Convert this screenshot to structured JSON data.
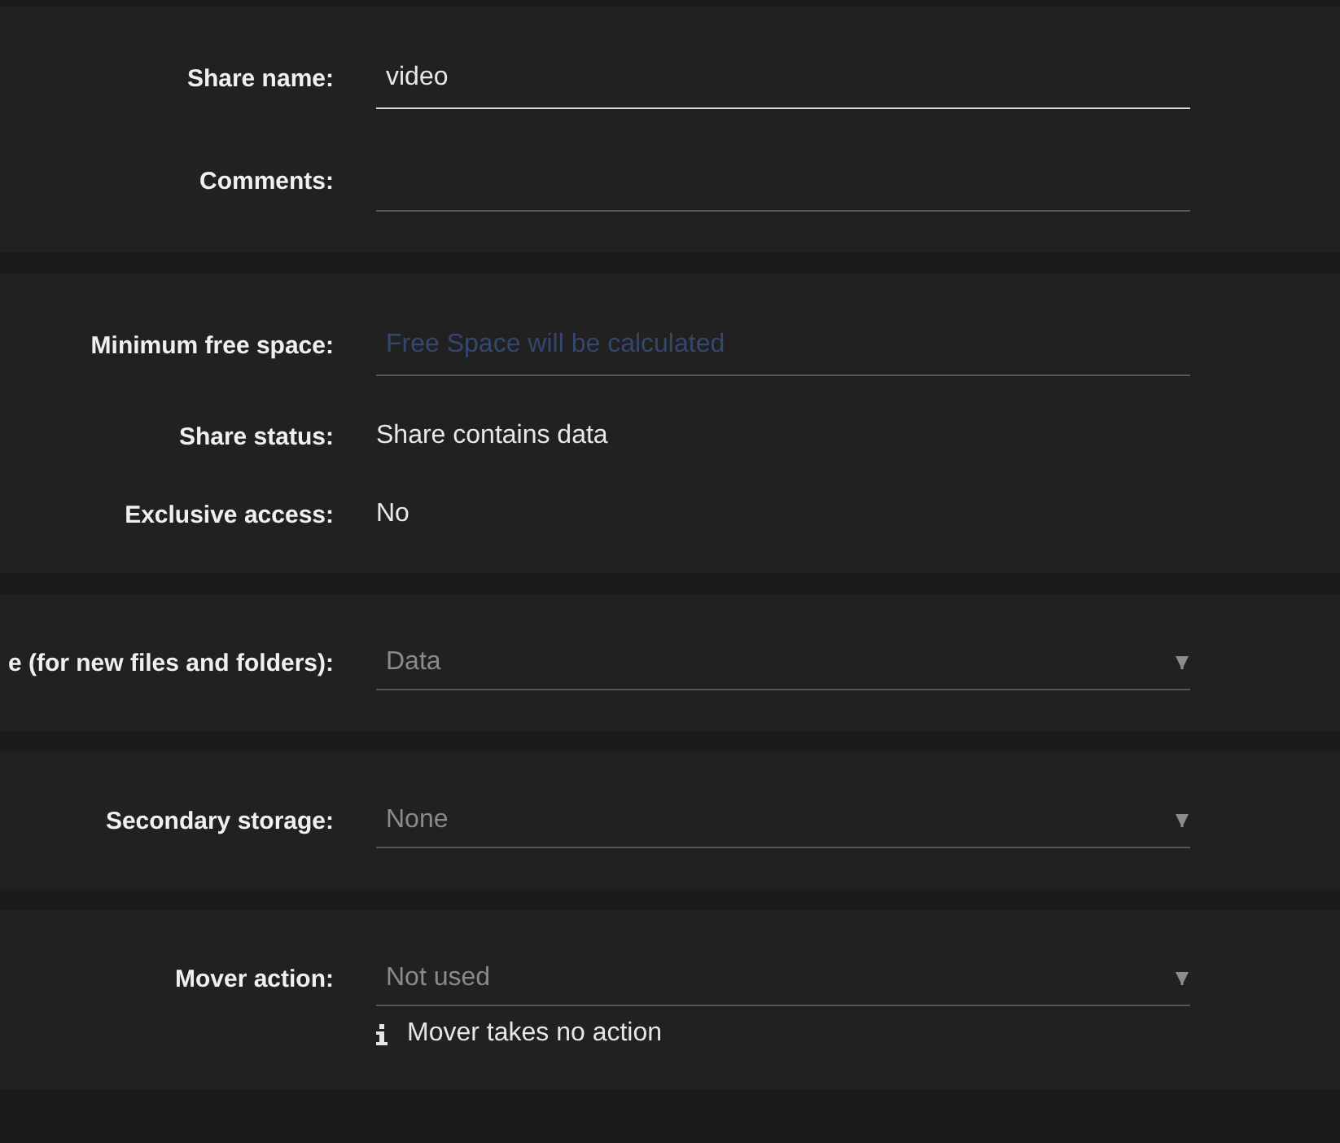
{
  "panels": [
    {
      "rows": [
        {
          "kind": "input",
          "label": "Share name:",
          "value": "video",
          "focused": true
        },
        {
          "kind": "input",
          "label": "Comments:",
          "focused": false
        }
      ]
    },
    {
      "rows": [
        {
          "kind": "input",
          "label": "Minimum free space:",
          "placeholder": "Free Space will be calculated",
          "focused": false
        },
        {
          "kind": "static",
          "label": "Share status:",
          "value": "Share contains data"
        },
        {
          "kind": "static",
          "label": "Exclusive access:",
          "value": "No"
        }
      ]
    },
    {
      "rows": [
        {
          "kind": "select",
          "label": "e (for new files and folders):",
          "value": "Data",
          "focused": false
        }
      ]
    },
    {
      "rows": [
        {
          "kind": "select",
          "label": "Secondary storage:",
          "value": "None",
          "focused": false
        }
      ]
    },
    {
      "rows": [
        {
          "kind": "select",
          "label": "Mover action:",
          "value": "Not used",
          "focused": false,
          "hint": "Mover takes no action"
        }
      ]
    }
  ]
}
